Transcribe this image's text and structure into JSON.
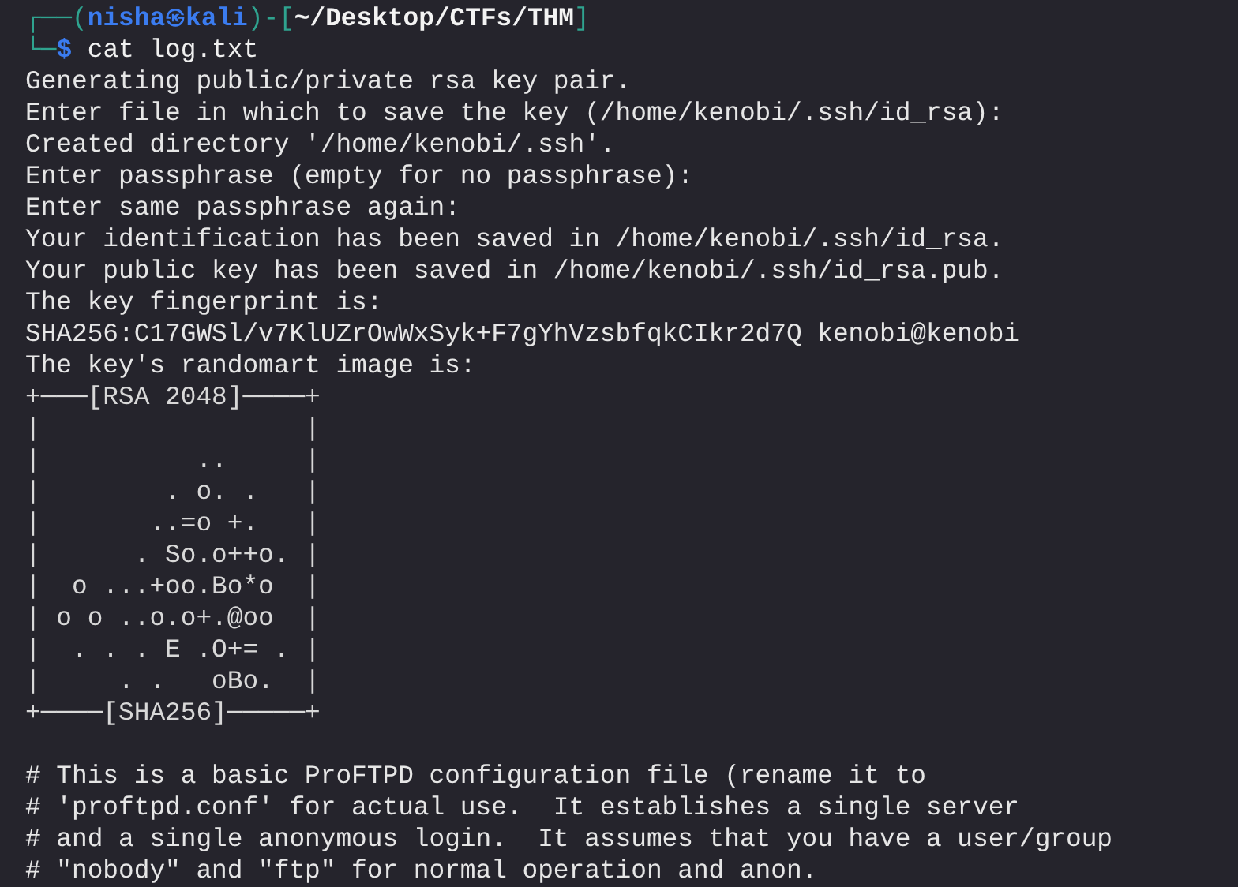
{
  "prompt": {
    "lines": [
      [
        {
          "kind": "frame",
          "text": "┌──("
        },
        {
          "kind": "user",
          "text": "nisha"
        },
        {
          "kind": "at",
          "text": "㉿"
        },
        {
          "kind": "user",
          "text": "kali"
        },
        {
          "kind": "frame",
          "text": ")-["
        },
        {
          "kind": "path",
          "text": "~/Desktop/CTFs/THM"
        },
        {
          "kind": "frame",
          "text": "]"
        }
      ],
      [
        {
          "kind": "frame",
          "text": "└─"
        },
        {
          "kind": "symbol",
          "text": "$"
        },
        {
          "kind": "command",
          "text": " cat log.txt"
        }
      ]
    ]
  },
  "output": [
    {
      "kind": "text",
      "text": "Generating public/private rsa key pair."
    },
    {
      "kind": "text",
      "text": "Enter file in which to save the key (/home/kenobi/.ssh/id_rsa):"
    },
    {
      "kind": "text",
      "text": "Created directory '/home/kenobi/.ssh'."
    },
    {
      "kind": "text",
      "text": "Enter passphrase (empty for no passphrase):"
    },
    {
      "kind": "text",
      "text": "Enter same passphrase again:"
    },
    {
      "kind": "text",
      "text": "Your identification has been saved in /home/kenobi/.ssh/id_rsa."
    },
    {
      "kind": "text",
      "text": "Your public key has been saved in /home/kenobi/.ssh/id_rsa.pub."
    },
    {
      "kind": "text",
      "text": "The key fingerprint is:"
    },
    {
      "kind": "text",
      "text": "SHA256:C17GWSl/v7KlUZrOwWxSyk+F7gYhVzsbfqkCIkr2d7Q kenobi@kenobi"
    },
    {
      "kind": "text",
      "text": "The key's randomart image is:"
    },
    {
      "kind": "art",
      "text": "+───[RSA 2048]────+"
    },
    {
      "kind": "art",
      "text": "|                 |"
    },
    {
      "kind": "art",
      "text": "|          ..     |"
    },
    {
      "kind": "art",
      "text": "|        . o. .   |"
    },
    {
      "kind": "art",
      "text": "|       ..=o +.   |"
    },
    {
      "kind": "art",
      "text": "|      . So.o++o. |"
    },
    {
      "kind": "art",
      "text": "|  o ...+oo.Bo*o  |"
    },
    {
      "kind": "art",
      "text": "| o o ..o.o+.@oo  |"
    },
    {
      "kind": "art",
      "text": "|  . . . E .O+= . |"
    },
    {
      "kind": "art",
      "text": "|     . .   oBo.  |"
    },
    {
      "kind": "art",
      "text": "+────[SHA256]─────+"
    },
    {
      "kind": "blank"
    },
    {
      "kind": "text",
      "text": "# This is a basic ProFTPD configuration file (rename it to"
    },
    {
      "kind": "text",
      "text": "# 'proftpd.conf' for actual use.  It establishes a single server"
    },
    {
      "kind": "text",
      "text": "# and a single anonymous login.  It assumes that you have a user/group"
    },
    {
      "kind": "text",
      "text": "# \"nobody\" and \"ftp\" for normal operation and anon."
    }
  ]
}
